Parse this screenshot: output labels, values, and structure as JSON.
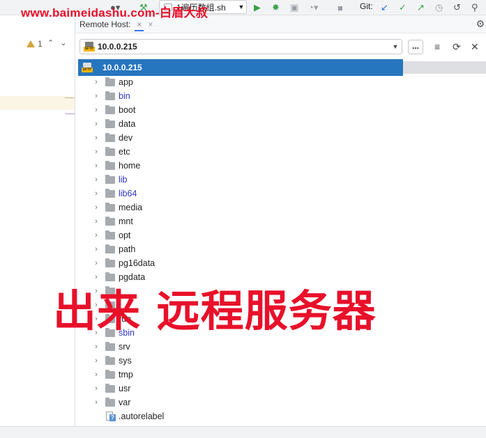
{
  "watermark": "www.baimeidashu.com-白眉大叔",
  "toolbar": {
    "run_config_label": "1遍历数组.sh",
    "git_label": "Git:",
    "colors": {
      "run": "#3aa04a",
      "git_update": "#2f6fd6",
      "git_check": "#3aa04a"
    }
  },
  "left": {
    "warning_count": "1"
  },
  "remote_host": {
    "title": "Remote Host:",
    "host_value": "10.0.0.215",
    "browse_label": "...",
    "dropdown_selected": "10.0.0.215"
  },
  "tree": {
    "folders": [
      {
        "name": "app",
        "link": false
      },
      {
        "name": "bin",
        "link": true
      },
      {
        "name": "boot",
        "link": false
      },
      {
        "name": "data",
        "link": false
      },
      {
        "name": "dev",
        "link": false
      },
      {
        "name": "etc",
        "link": false
      },
      {
        "name": "home",
        "link": false
      },
      {
        "name": "lib",
        "link": true
      },
      {
        "name": "lib64",
        "link": true
      },
      {
        "name": "media",
        "link": false
      },
      {
        "name": "mnt",
        "link": false
      },
      {
        "name": "opt",
        "link": false
      },
      {
        "name": "path",
        "link": false
      },
      {
        "name": "pg16data",
        "link": false
      },
      {
        "name": "pgdata",
        "link": false
      },
      {
        "name": "",
        "link": false
      },
      {
        "name": "",
        "link": false
      },
      {
        "name": "run",
        "link": false
      },
      {
        "name": "sbin",
        "link": true
      },
      {
        "name": "srv",
        "link": false
      },
      {
        "name": "sys",
        "link": false
      },
      {
        "name": "tmp",
        "link": false
      },
      {
        "name": "usr",
        "link": false
      },
      {
        "name": "var",
        "link": false
      }
    ],
    "file": ".autorelabel"
  },
  "overlay_caption": "出来 远程服务器"
}
